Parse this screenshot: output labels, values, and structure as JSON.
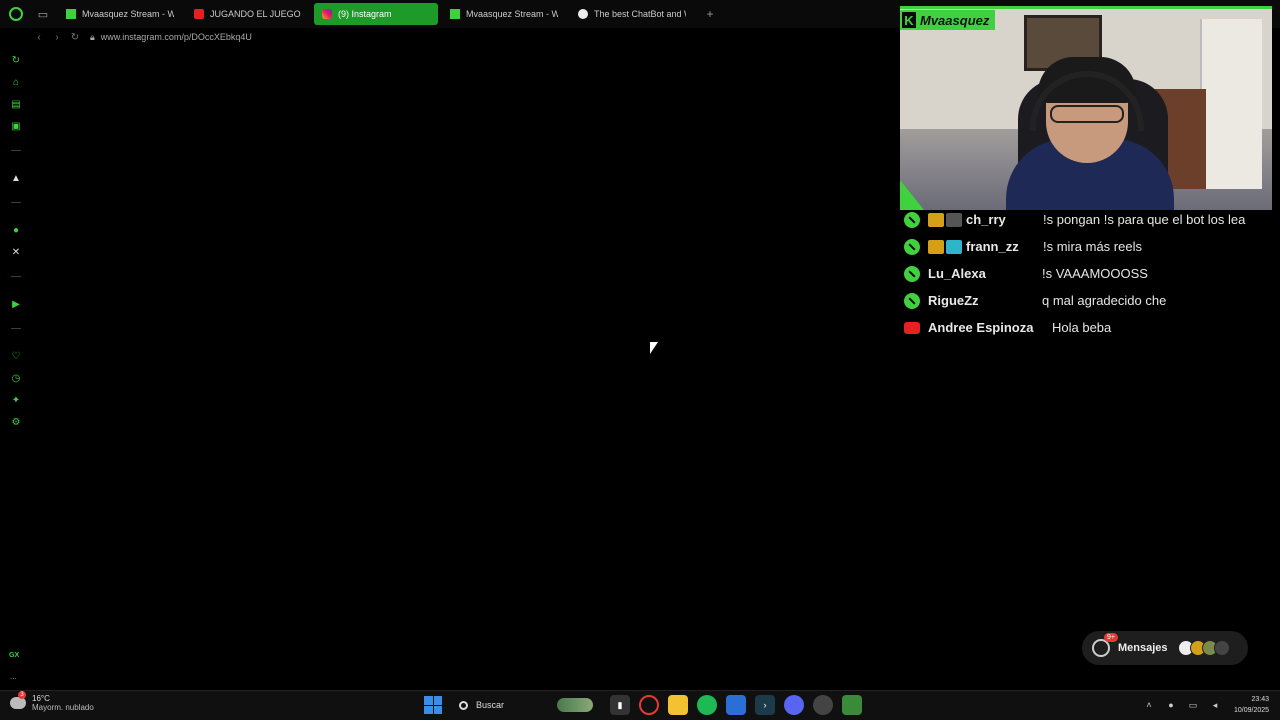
{
  "tabs": [
    {
      "label": "Mvaasquez Stream - Wat",
      "favicon": "kick-icon",
      "active": false
    },
    {
      "label": "JUGANDO EL JUEGO DE",
      "favicon": "youtube-icon",
      "active": false
    },
    {
      "label": "(9) Instagram",
      "favicon": "instagram-icon",
      "active": true
    },
    {
      "label": "Mvaasquez Stream - Wat",
      "favicon": "kick-icon",
      "active": false
    },
    {
      "label": "The best ChatBot and Wi",
      "favicon": "chatbot-icon",
      "active": false
    }
  ],
  "address": {
    "url": "www.instagram.com/p/DOccXEbkq4U"
  },
  "stream": {
    "streamer_name": "Mvaasquez",
    "accent_color": "#3fd13f"
  },
  "chat": [
    {
      "platform": "kick",
      "user": "ch_rry",
      "message": "!s pongan !s para que el bot los lea",
      "badges": [
        "#d4a017",
        "#555555"
      ]
    },
    {
      "platform": "kick",
      "user": "frann_zz",
      "message": "!s mira más reels",
      "badges": [
        "#d4a017",
        "#2fb5c9"
      ]
    },
    {
      "platform": "kick",
      "user": "Lu_Alexa",
      "message": "!s VAAAMOOOSS",
      "badges": []
    },
    {
      "platform": "kick",
      "user": "RigueZz",
      "message": "q mal agradecido che",
      "badges": []
    },
    {
      "platform": "youtube",
      "user": "Andree Espinoza",
      "message": "Hola beba",
      "badges": []
    }
  ],
  "messages_widget": {
    "label": "Mensajes",
    "badge": "9+"
  },
  "sidebar": {
    "gx_label": "GX",
    "more": "..."
  },
  "taskbar": {
    "weather_temp": "16°C",
    "weather_desc": "Mayorm. nublado",
    "weather_badge": "3",
    "search_placeholder": "Buscar",
    "time": "23:43",
    "date": "10/09/2025"
  }
}
